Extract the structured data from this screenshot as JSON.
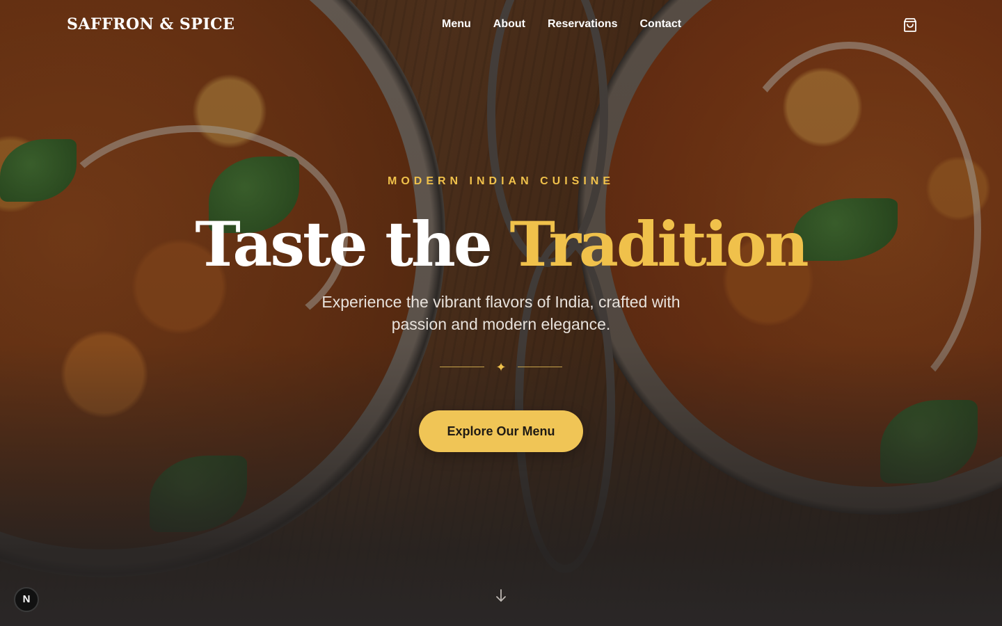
{
  "brand": {
    "logo_text": "SAFFRON & SPICE"
  },
  "nav": {
    "links": [
      {
        "label": "Menu"
      },
      {
        "label": "About"
      },
      {
        "label": "Reservations"
      },
      {
        "label": "Contact"
      }
    ],
    "cart_icon": "shopping-bag-icon"
  },
  "hero": {
    "eyebrow": "MODERN INDIAN CUISINE",
    "headline_main": "Taste the",
    "headline_accent": "Tradition",
    "subtitle": "Experience the vibrant flavors of India, crafted with passion and modern elegance.",
    "divider_icon": "sparkle-icon",
    "divider_glyph": "✦",
    "cta_label": "Explore Our Menu",
    "scroll_icon": "arrow-down-icon"
  },
  "dev_badge": {
    "label": "N",
    "icon": "nextjs-badge-icon"
  },
  "colors": {
    "accent": "#f0c14b",
    "button_bg": "#f0c556",
    "button_text": "#1f1a14",
    "text": "#ffffff"
  }
}
